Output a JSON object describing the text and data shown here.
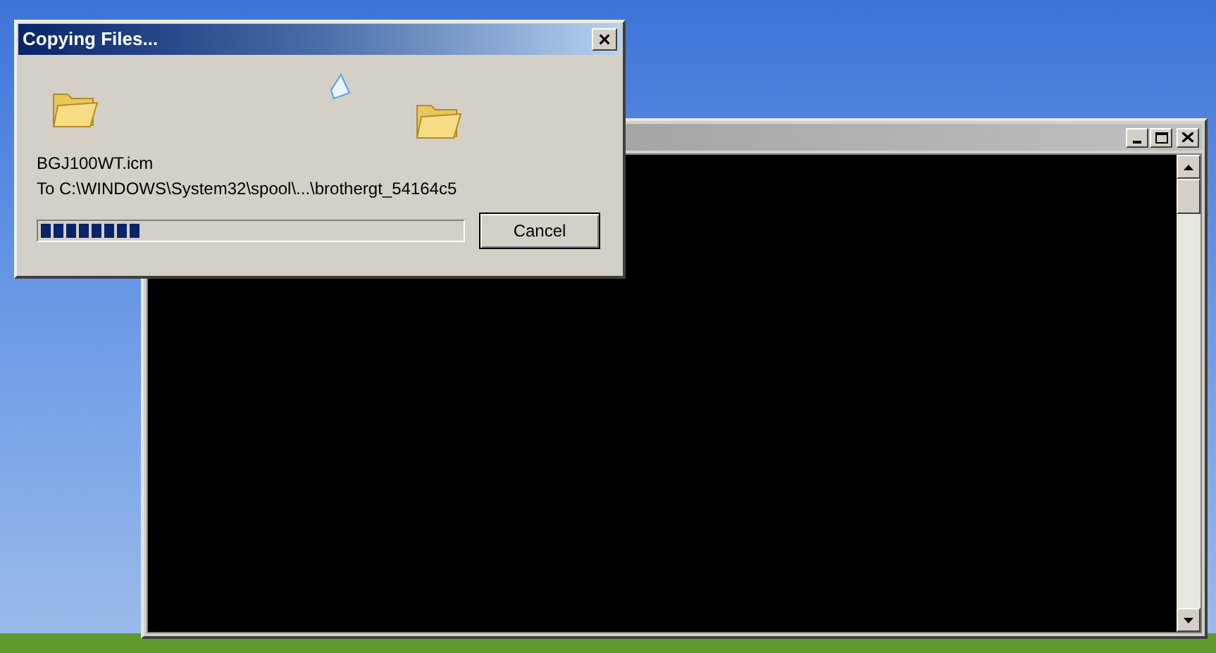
{
  "dialog": {
    "title": "Copying Files...",
    "close_glyph": "×",
    "file_name": "BGJ100WT.icm",
    "destination": "To C:\\WINDOWS\\System32\\spool\\...\\brothergt_54164c5",
    "progress": {
      "level": 0.24
    },
    "buttons": [
      "Cancel"
    ]
  },
  "console_window": {
    "active": false
  }
}
